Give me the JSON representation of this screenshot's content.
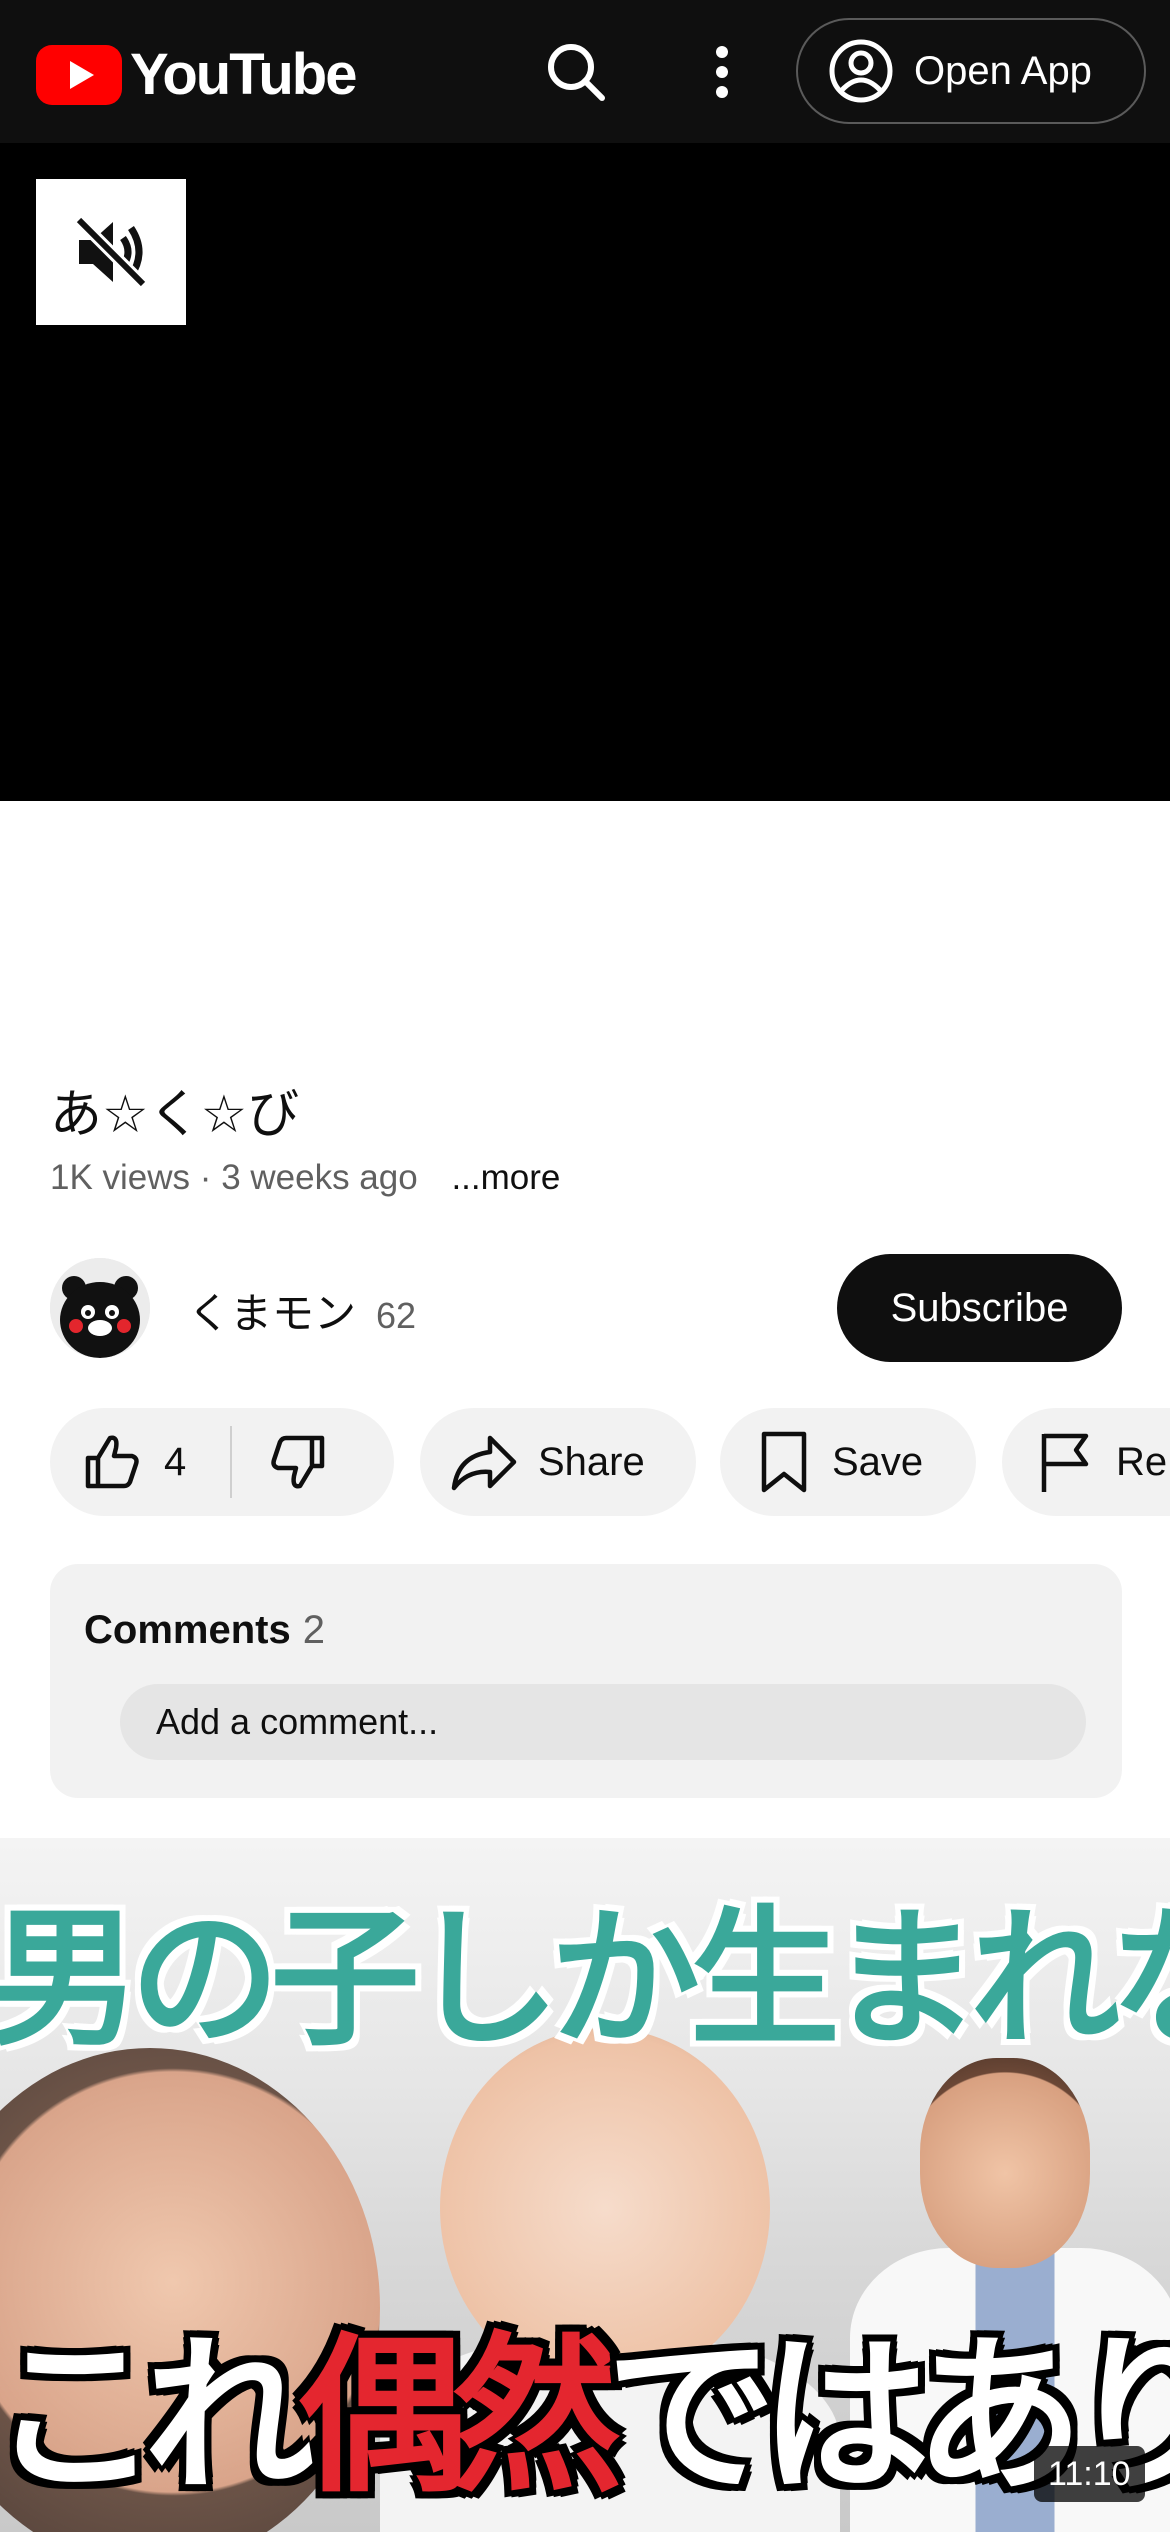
{
  "header": {
    "logo_text": "YouTube",
    "open_app_label": "Open App",
    "icons": [
      "youtube-logo-icon",
      "search-icon",
      "more-vert-icon",
      "account-circle-icon"
    ],
    "brand_color": "#ff0000"
  },
  "player": {
    "mute_icon": "volume-off-icon"
  },
  "video": {
    "title": "あ☆く☆び",
    "views": "1K views",
    "separator": "·",
    "age": "3 weeks ago",
    "more_label": "...more"
  },
  "channel": {
    "name": "くまモン",
    "subscriber_count": "62",
    "subscribe_label": "Subscribe"
  },
  "actions": {
    "like_count": "4",
    "share_label": "Share",
    "save_label": "Save",
    "report_label": "Re"
  },
  "comments": {
    "title": "Comments",
    "count": "2",
    "placeholder": "Add a comment..."
  },
  "next_video": {
    "thumb_text_top": "男の子しか生まれない",
    "thumb_text_bottom_a": "これ",
    "thumb_text_bottom_red": "偶然",
    "thumb_text_bottom_b": "ではありません",
    "duration": "11:10"
  }
}
